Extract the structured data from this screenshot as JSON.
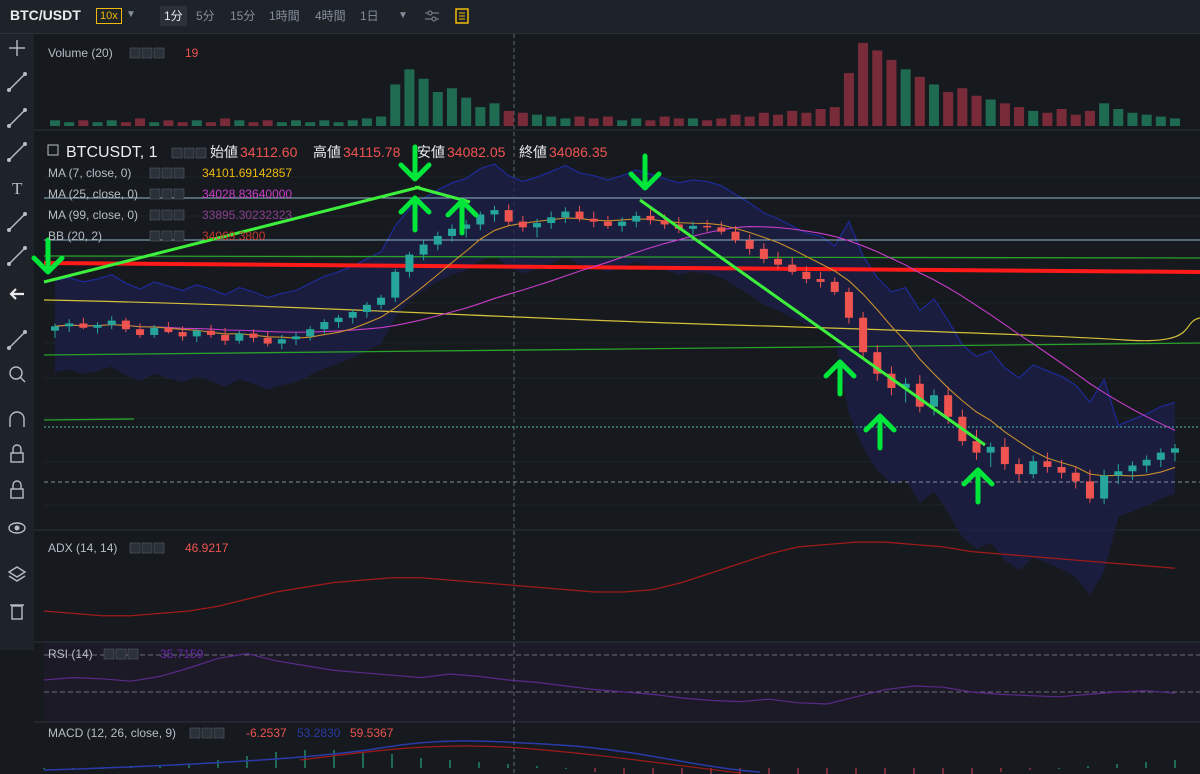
{
  "header": {
    "symbol": "BTC/USDT",
    "leverage": "10x",
    "intervals": [
      "1分",
      "5分",
      "15分",
      "1時間",
      "4時間",
      "1日"
    ],
    "active_interval": "1分"
  },
  "sidebar": {
    "tools": [
      "crosshair-icon",
      "trendline-icon",
      "fib-icon",
      "brush-icon",
      "text-icon",
      "pattern-icon",
      "measure-icon",
      "back-icon",
      "ruler-icon",
      "zoom-icon",
      "magnet-icon",
      "lock-draw-icon",
      "lock-icon",
      "eye-icon",
      "layers-icon",
      "trash-icon"
    ]
  },
  "panels": {
    "volume": {
      "title": "Volume (20)",
      "value": "19"
    },
    "main": {
      "title": "BTCUSDT, 1",
      "open_label": "始値",
      "open": "34112.60",
      "high_label": "高値",
      "high": "34115.78",
      "low_label": "安値",
      "low": "34082.05",
      "close_label": "終値",
      "close": "34086.35",
      "indicators": [
        {
          "name": "MA (7, close, 0)",
          "value": "34101.69142857",
          "color": "#f0b90b"
        },
        {
          "name": "MA (25, close, 0)",
          "value": "34028.83640000",
          "color": "#c83cc8"
        },
        {
          "name": "MA (99, close, 0)",
          "value": "33895.30232323",
          "color": "#8b3f8e"
        },
        {
          "name": "BB (20, 2)",
          "value": "34069.3800",
          "color": "#c0392b"
        }
      ]
    },
    "adx": {
      "title": "ADX (14, 14)",
      "value": "46.9217"
    },
    "rsi": {
      "title": "RSI (14)",
      "value": "35.7159"
    },
    "macd": {
      "title": "MACD (12, 26, close, 9)",
      "v1": "-6.2537",
      "v2": "53.2830",
      "v3": "59.5367"
    }
  },
  "colors": {
    "up": "#26a69a",
    "down": "#ef5350",
    "arrow": "#00e63a",
    "trend": "#3cf03c",
    "redline": "#ff1a1a"
  },
  "chart_data": {
    "type": "candlestick",
    "series": [
      {
        "name": "BTCUSDT",
        "ohlc": [
          [
            34025,
            34030,
            34020,
            34028
          ],
          [
            34028,
            34033,
            34024,
            34030
          ],
          [
            34030,
            34034,
            34026,
            34027
          ],
          [
            34027,
            34031,
            34023,
            34029
          ],
          [
            34029,
            34035,
            34026,
            34032
          ],
          [
            34032,
            34034,
            34024,
            34026
          ],
          [
            34026,
            34030,
            34020,
            34022
          ],
          [
            34022,
            34029,
            34020,
            34027
          ],
          [
            34027,
            34031,
            34023,
            34024
          ],
          [
            34024,
            34028,
            34018,
            34021
          ],
          [
            34021,
            34026,
            34017,
            34025
          ],
          [
            34025,
            34029,
            34020,
            34022
          ],
          [
            34022,
            34027,
            34015,
            34018
          ],
          [
            34018,
            34025,
            34016,
            34023
          ],
          [
            34023,
            34026,
            34017,
            34020
          ],
          [
            34020,
            34024,
            34014,
            34016
          ],
          [
            34016,
            34022,
            34012,
            34019
          ],
          [
            34019,
            34024,
            34015,
            34021
          ],
          [
            34021,
            34028,
            34018,
            34026
          ],
          [
            34026,
            34033,
            34023,
            34031
          ],
          [
            34031,
            34036,
            34027,
            34034
          ],
          [
            34034,
            34040,
            34030,
            34038
          ],
          [
            34038,
            34045,
            34034,
            34043
          ],
          [
            34043,
            34050,
            34040,
            34048
          ],
          [
            34048,
            34068,
            34045,
            34066
          ],
          [
            34066,
            34080,
            34062,
            34078
          ],
          [
            34078,
            34088,
            34074,
            34085
          ],
          [
            34085,
            34094,
            34081,
            34091
          ],
          [
            34091,
            34099,
            34087,
            34096
          ],
          [
            34096,
            34102,
            34090,
            34099
          ],
          [
            34099,
            34108,
            34095,
            34106
          ],
          [
            34106,
            34112,
            34101,
            34109
          ],
          [
            34109,
            34113,
            34098,
            34101
          ],
          [
            34101,
            34105,
            34094,
            34097
          ],
          [
            34097,
            34103,
            34090,
            34100
          ],
          [
            34100,
            34108,
            34096,
            34104
          ],
          [
            34104,
            34111,
            34100,
            34108
          ],
          [
            34108,
            34112,
            34101,
            34103
          ],
          [
            34103,
            34108,
            34097,
            34101
          ],
          [
            34101,
            34105,
            34096,
            34098
          ],
          [
            34098,
            34104,
            34094,
            34101
          ],
          [
            34101,
            34108,
            34097,
            34105
          ],
          [
            34105,
            34110,
            34099,
            34102
          ],
          [
            34102,
            34106,
            34096,
            34099
          ],
          [
            34099,
            34104,
            34093,
            34096
          ],
          [
            34096,
            34101,
            34092,
            34098
          ],
          [
            34098,
            34102,
            34094,
            34097
          ],
          [
            34097,
            34101,
            34092,
            34094
          ],
          [
            34094,
            34098,
            34086,
            34088
          ],
          [
            34088,
            34092,
            34078,
            34082
          ],
          [
            34082,
            34086,
            34072,
            34075
          ],
          [
            34075,
            34080,
            34068,
            34071
          ],
          [
            34071,
            34076,
            34064,
            34066
          ],
          [
            34066,
            34070,
            34058,
            34061
          ],
          [
            34061,
            34066,
            34055,
            34059
          ],
          [
            34059,
            34062,
            34050,
            34052
          ],
          [
            34052,
            34055,
            34030,
            34034
          ],
          [
            34034,
            34038,
            34005,
            34010
          ],
          [
            34010,
            34015,
            33990,
            33995
          ],
          [
            33995,
            34000,
            33980,
            33985
          ],
          [
            33985,
            33992,
            33975,
            33988
          ],
          [
            33988,
            33994,
            33968,
            33972
          ],
          [
            33972,
            33984,
            33966,
            33980
          ],
          [
            33980,
            33986,
            33960,
            33965
          ],
          [
            33965,
            33970,
            33945,
            33948
          ],
          [
            33948,
            33956,
            33935,
            33940
          ],
          [
            33940,
            33947,
            33930,
            33944
          ],
          [
            33944,
            33950,
            33928,
            33932
          ],
          [
            33932,
            33936,
            33920,
            33925
          ],
          [
            33925,
            33938,
            33922,
            33934
          ],
          [
            33934,
            33940,
            33926,
            33930
          ],
          [
            33930,
            33935,
            33922,
            33926
          ],
          [
            33926,
            33930,
            33915,
            33920
          ],
          [
            33920,
            33928,
            33905,
            33908
          ],
          [
            33908,
            33928,
            33904,
            33924
          ],
          [
            33924,
            33932,
            33918,
            33927
          ],
          [
            33927,
            33934,
            33921,
            33931
          ],
          [
            33931,
            33938,
            33926,
            33935
          ],
          [
            33935,
            33943,
            33930,
            33940
          ],
          [
            33940,
            33946,
            33934,
            33943
          ]
        ]
      }
    ],
    "volume": [
      3,
      2,
      3,
      2,
      3,
      2,
      4,
      2,
      3,
      2,
      3,
      2,
      4,
      3,
      2,
      3,
      2,
      3,
      2,
      3,
      2,
      3,
      4,
      5,
      22,
      30,
      25,
      18,
      20,
      15,
      10,
      12,
      8,
      7,
      6,
      5,
      4,
      5,
      4,
      5,
      3,
      4,
      3,
      5,
      4,
      4,
      3,
      4,
      6,
      5,
      7,
      6,
      8,
      7,
      9,
      10,
      28,
      44,
      40,
      35,
      30,
      26,
      22,
      18,
      20,
      16,
      14,
      12,
      10,
      8,
      7,
      9,
      6,
      8,
      12,
      9,
      7,
      6,
      5,
      4
    ],
    "adx": [
      18,
      17,
      16,
      16,
      17,
      18,
      20,
      23,
      26,
      28,
      30,
      31,
      32,
      32,
      31,
      30,
      29,
      28,
      27,
      26,
      26,
      27,
      30,
      34,
      38,
      42,
      45,
      46,
      47,
      47,
      46,
      45,
      43,
      42,
      41,
      40,
      39,
      38,
      37,
      36
    ],
    "rsi": [
      50,
      52,
      51,
      49,
      53,
      60,
      68,
      72,
      66,
      62,
      58,
      56,
      54,
      52,
      55,
      53,
      50,
      48,
      45,
      42,
      40,
      38,
      35,
      33,
      32,
      34,
      31,
      30,
      36,
      42,
      45,
      44,
      40,
      38,
      37,
      36,
      38,
      40,
      41,
      39
    ],
    "macd_hist": [
      0,
      0,
      0,
      1,
      1,
      2,
      4,
      6,
      8,
      9,
      9,
      8,
      7,
      5,
      4,
      3,
      2,
      1,
      0,
      -2,
      -4,
      -7,
      -9,
      -11,
      -12,
      -12,
      -11,
      -10,
      -8,
      -7,
      -5,
      -4,
      -3,
      -2,
      -1,
      0,
      1,
      2,
      3,
      4
    ]
  }
}
